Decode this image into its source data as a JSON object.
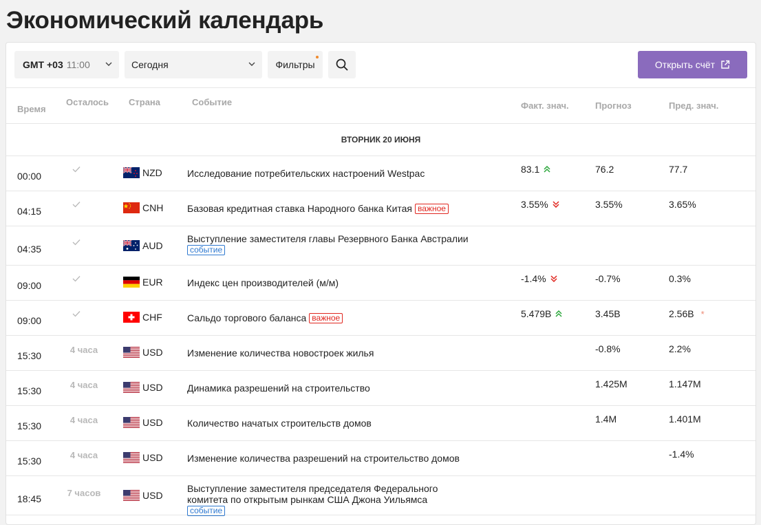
{
  "page_title": "Экономический календарь",
  "toolbar": {
    "timezone_label": "GMT +03",
    "timezone_time": "11:00",
    "date_value": "Сегодня",
    "filters_label": "Фильтры",
    "open_account_label": "Открыть счёт"
  },
  "columns": {
    "time": "Время",
    "left": "Осталось",
    "country": "Страна",
    "event": "Событие",
    "actual": "Факт. знач.",
    "forecast": "Прогноз",
    "previous": "Пред. знач."
  },
  "day_header": "ВТОРНИК 20 ИЮНЯ",
  "badges": {
    "important": "важное",
    "event": "событие"
  },
  "colors": {
    "accent": "#8a6bbd",
    "up": "#2aa63a",
    "down": "#e0261f",
    "important": "#e0261f",
    "event": "#2d78d0"
  },
  "rows": [
    {
      "time": "00:00",
      "left": "",
      "done": true,
      "flag": "nz",
      "currency": "NZD",
      "event": "Исследование потребительских настроений Westpac",
      "badge": "",
      "actual": "83.1",
      "trend": "up",
      "forecast": "76.2",
      "previous": "77.7",
      "revised": false
    },
    {
      "time": "04:15",
      "left": "",
      "done": true,
      "flag": "cn",
      "currency": "CNH",
      "event": "Базовая кредитная ставка Народного банка Китая",
      "badge": "important",
      "actual": "3.55%",
      "trend": "down",
      "forecast": "3.55%",
      "previous": "3.65%",
      "revised": false
    },
    {
      "time": "04:35",
      "left": "",
      "done": true,
      "flag": "au",
      "currency": "AUD",
      "event": "Выступление заместителя главы Резервного Банка Австралии",
      "badge": "event",
      "actual": "",
      "trend": "",
      "forecast": "",
      "previous": "",
      "revised": false
    },
    {
      "time": "09:00",
      "left": "",
      "done": true,
      "flag": "de",
      "currency": "EUR",
      "event": "Индекс цен производителей (м/м)",
      "badge": "",
      "actual": "-1.4%",
      "trend": "down",
      "forecast": "-0.7%",
      "previous": "0.3%",
      "revised": false
    },
    {
      "time": "09:00",
      "left": "",
      "done": true,
      "flag": "ch",
      "currency": "CHF",
      "event": "Сальдо торгового баланса",
      "badge": "important",
      "actual": "5.479B",
      "trend": "up",
      "forecast": "3.45B",
      "previous": "2.56B",
      "revised": true
    },
    {
      "time": "15:30",
      "left": "4 часа",
      "done": false,
      "flag": "us",
      "currency": "USD",
      "event": "Изменение количества новостроек жилья",
      "badge": "",
      "actual": "",
      "trend": "",
      "forecast": "-0.8%",
      "previous": "2.2%",
      "revised": false
    },
    {
      "time": "15:30",
      "left": "4 часа",
      "done": false,
      "flag": "us",
      "currency": "USD",
      "event": "Динамика разрешений на строительство",
      "badge": "",
      "actual": "",
      "trend": "",
      "forecast": "1.425M",
      "previous": "1.147M",
      "revised": false
    },
    {
      "time": "15:30",
      "left": "4 часа",
      "done": false,
      "flag": "us",
      "currency": "USD",
      "event": "Количество начатых строительств домов",
      "badge": "",
      "actual": "",
      "trend": "",
      "forecast": "1.4M",
      "previous": "1.401M",
      "revised": false
    },
    {
      "time": "15:30",
      "left": "4 часа",
      "done": false,
      "flag": "us",
      "currency": "USD",
      "event": "Изменение количества разрешений на строительство домов",
      "badge": "",
      "actual": "",
      "trend": "",
      "forecast": "",
      "previous": "-1.4%",
      "revised": false
    },
    {
      "time": "18:45",
      "left": "7 часов",
      "done": false,
      "flag": "us",
      "currency": "USD",
      "event": "Выступление заместителя председателя Федерального комитета по открытым рынкам США Джона Уильямса",
      "badge": "event",
      "actual": "",
      "trend": "",
      "forecast": "",
      "previous": "",
      "revised": false
    }
  ]
}
